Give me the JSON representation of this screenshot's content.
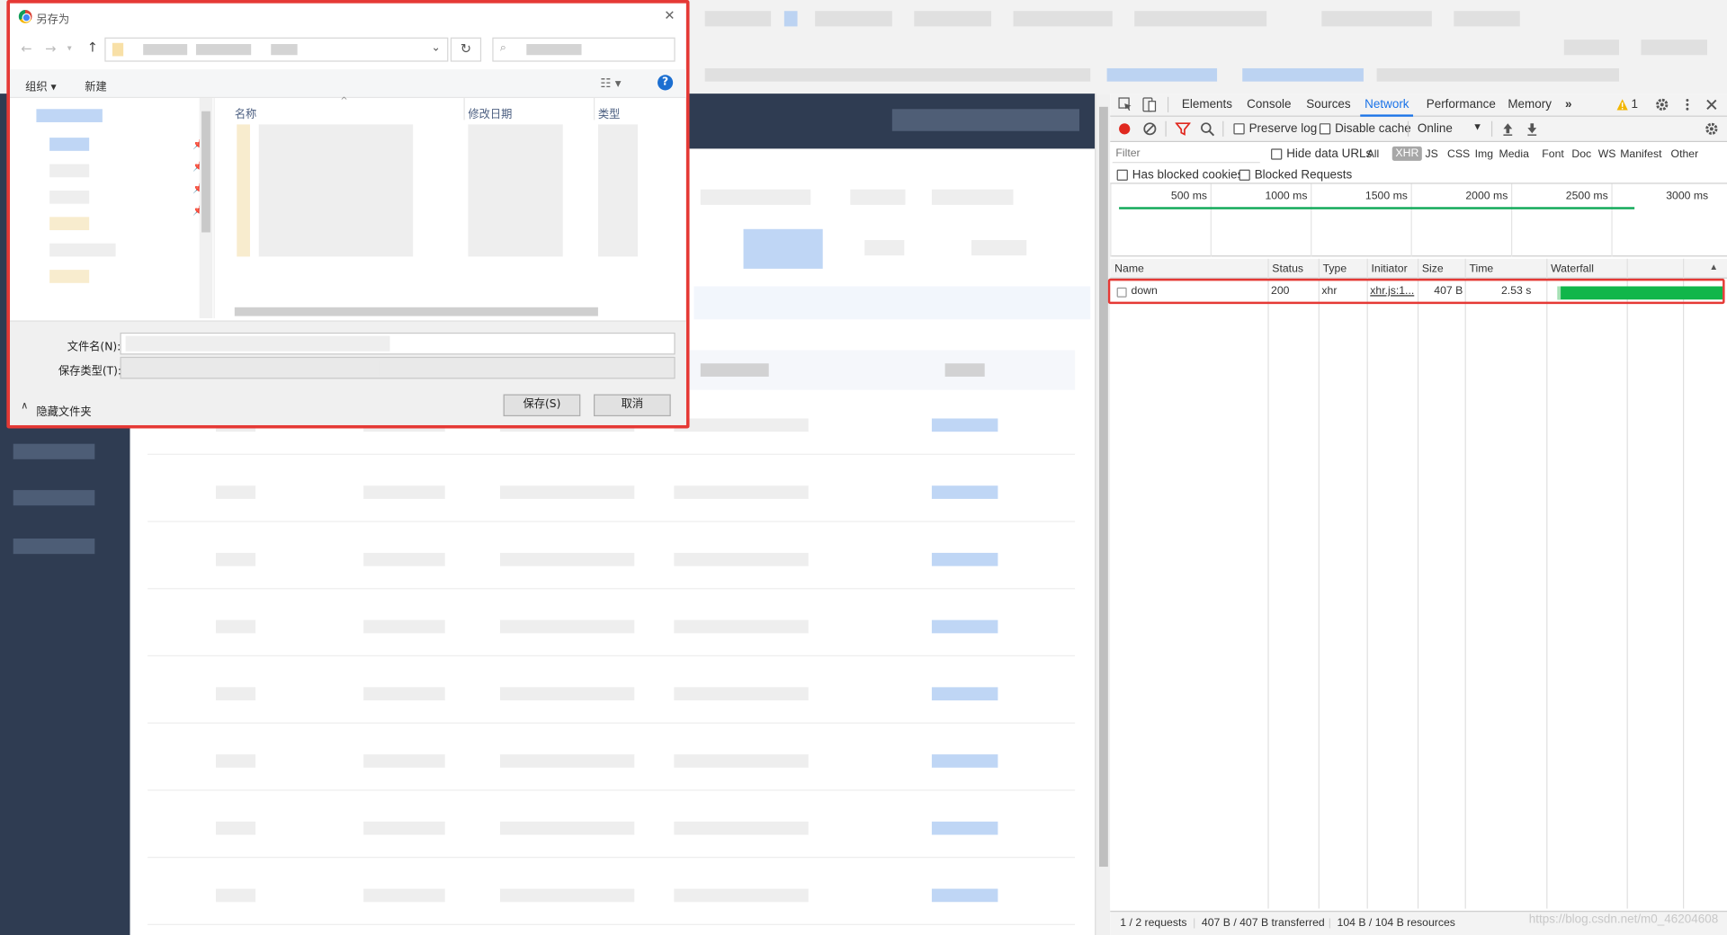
{
  "dialog": {
    "title": "另存为",
    "organize_label": "组织 ▾",
    "new_folder_label": "新建",
    "columns": {
      "name": "名称",
      "modified": "修改日期",
      "type": "类型"
    },
    "filename_label": "文件名(N):",
    "filetype_label": "保存类型(T):",
    "hide_folders_label": "隐藏文件夹",
    "save_label": "保存(S)",
    "cancel_label": "取消"
  },
  "devtools": {
    "tabs": [
      "Elements",
      "Console",
      "Sources",
      "Network",
      "Performance",
      "Memory"
    ],
    "active_tab": "Network",
    "more_tabs": "»",
    "warning_count": "1",
    "toolbar": {
      "preserve_log": "Preserve log",
      "disable_cache": "Disable cache",
      "throttle": "Online"
    },
    "filter": {
      "placeholder": "Filter",
      "hide_data_urls": "Hide data URLs",
      "types": [
        "All",
        "XHR",
        "JS",
        "CSS",
        "Img",
        "Media",
        "Font",
        "Doc",
        "WS",
        "Manifest",
        "Other"
      ],
      "active_type": "XHR",
      "has_blocked_cookies": "Has blocked cookies",
      "blocked_requests": "Blocked Requests"
    },
    "timeline_ticks": [
      "500 ms",
      "1000 ms",
      "1500 ms",
      "2000 ms",
      "2500 ms",
      "3000 ms"
    ],
    "table": {
      "headers": [
        "Name",
        "Status",
        "Type",
        "Initiator",
        "Size",
        "Time",
        "Waterfall"
      ],
      "rows": [
        {
          "name": "down",
          "status": "200",
          "type": "xhr",
          "initiator": "xhr.js:1...",
          "size": "407 B",
          "time": "2.53 s"
        }
      ]
    },
    "status": {
      "requests": "1 / 2 requests",
      "transferred": "407 B / 407 B transferred",
      "resources": "104 B / 104 B resources"
    }
  },
  "watermark": "https://blog.csdn.net/m0_46204608",
  "colors": {
    "highlight": "#e53935",
    "waterfall": "#11b64a",
    "accent": "#1a73e8"
  }
}
